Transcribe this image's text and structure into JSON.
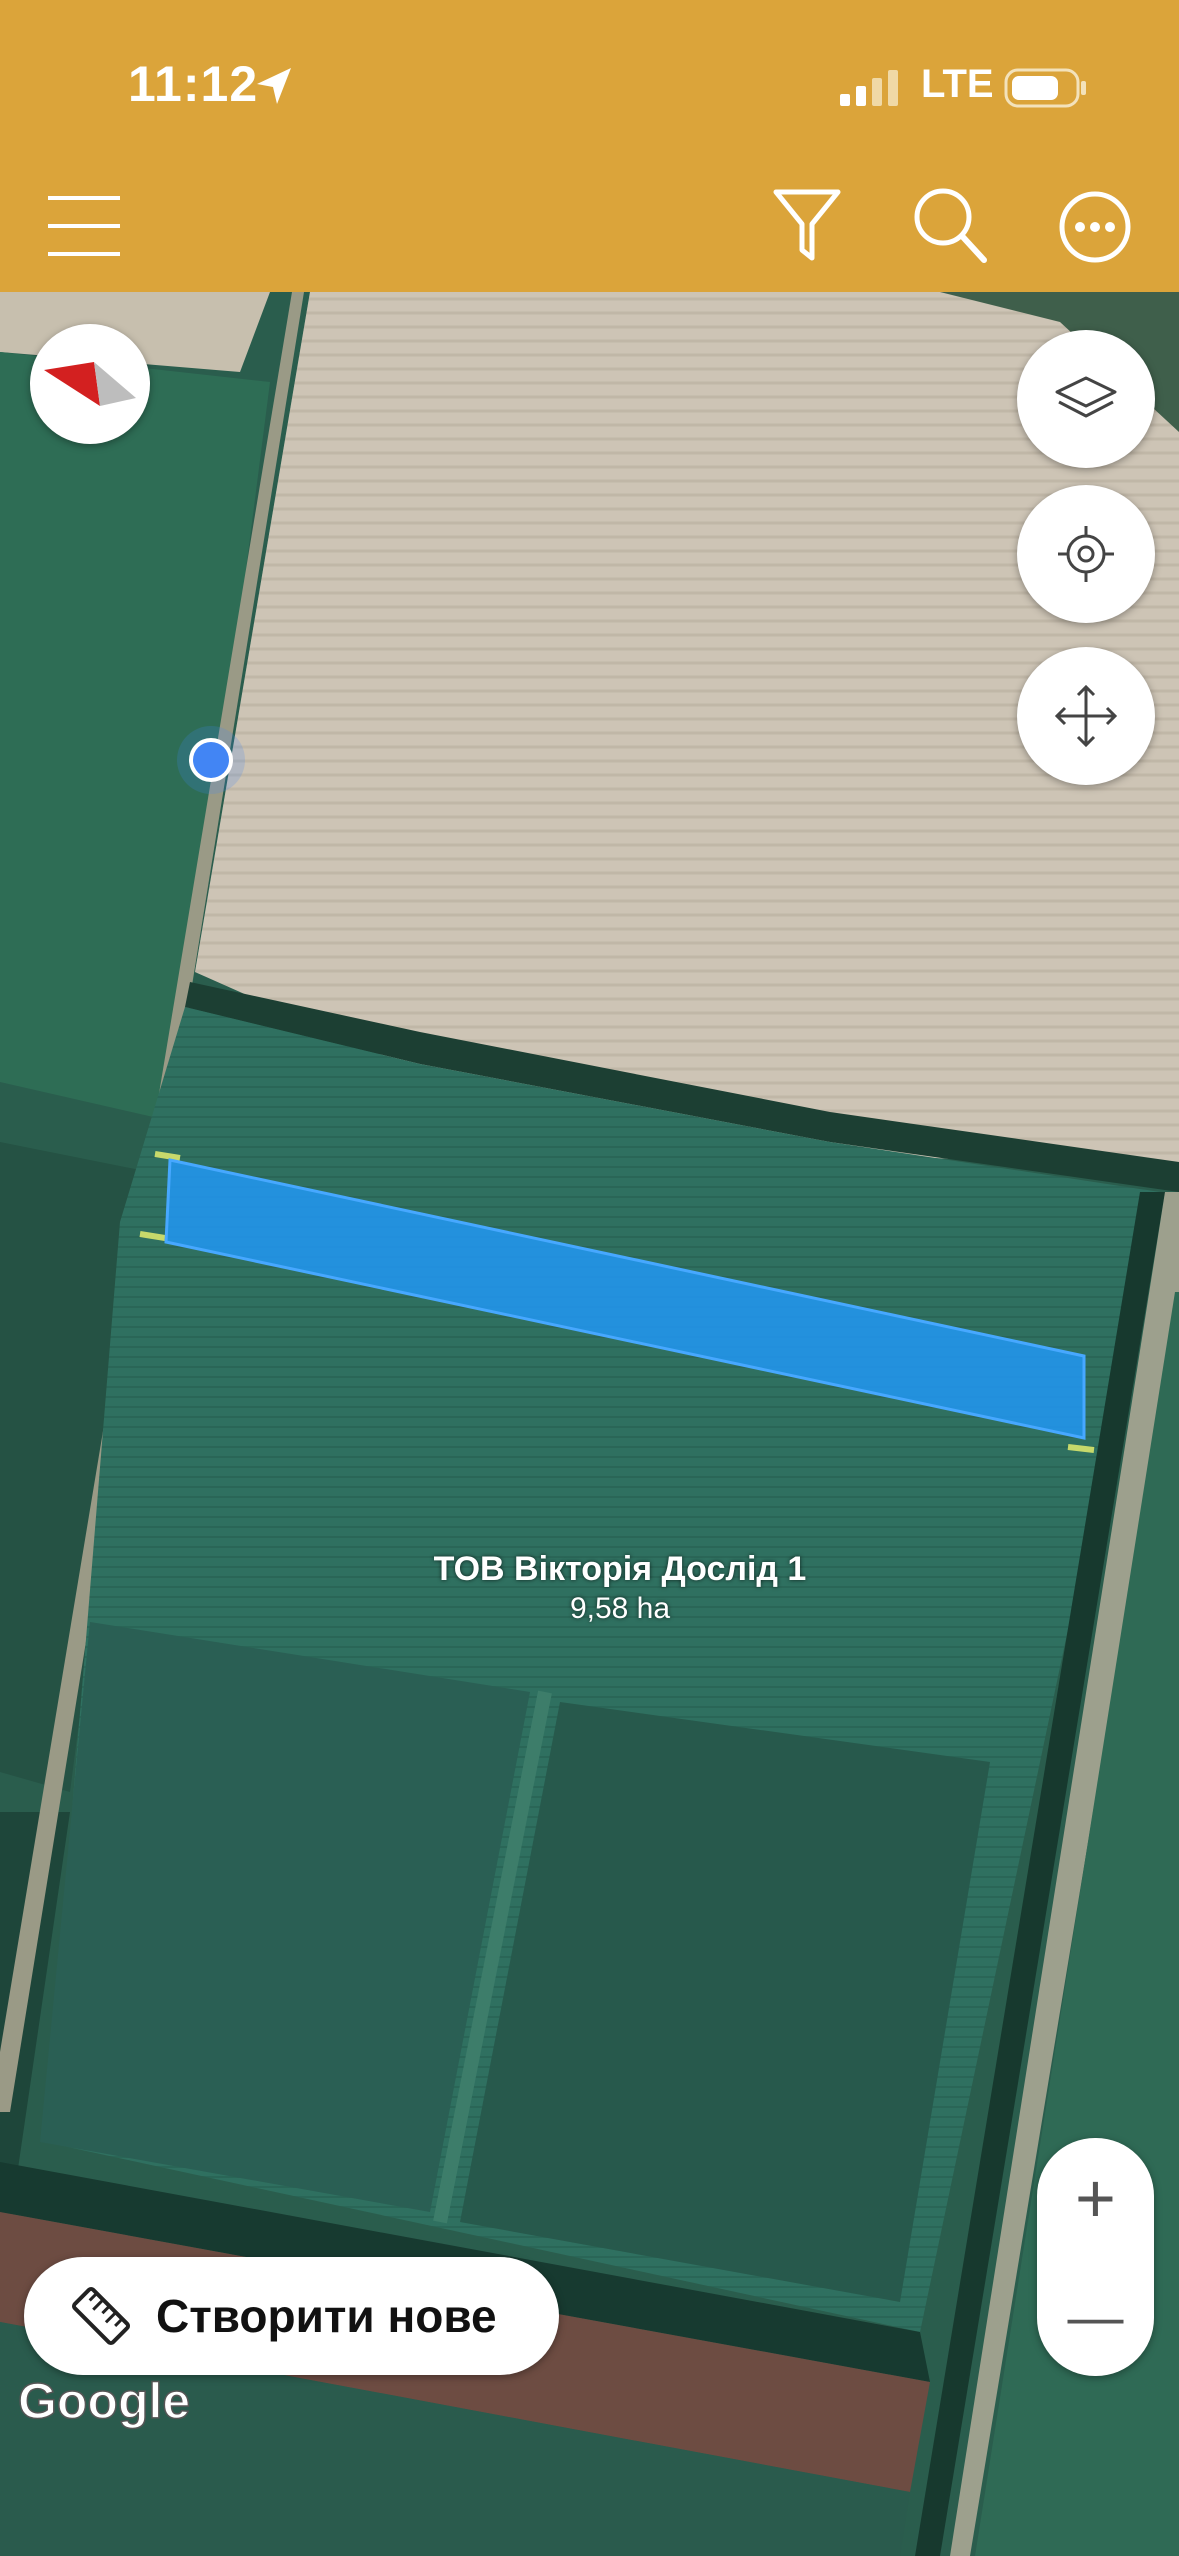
{
  "status_bar": {
    "time": "11:12",
    "network": "LTE"
  },
  "toolbar": {
    "icons": [
      "menu-icon",
      "filter-icon",
      "search-icon",
      "more-icon"
    ]
  },
  "map": {
    "controls": [
      "compass-icon",
      "layers-icon",
      "my-location-icon",
      "pan-icon"
    ],
    "field": {
      "name": "ТОВ Вікторія Дослід 1",
      "area": "9,58 ha",
      "fill_color": "#2196F3"
    },
    "zoom": {
      "in_symbol": "+",
      "out_symbol": "—"
    },
    "create_button_label": "Створити нове",
    "attribution": "Google"
  },
  "colors": {
    "header": "#DBA43A",
    "accent": "#2196F3",
    "user_location": "#4285F4"
  }
}
